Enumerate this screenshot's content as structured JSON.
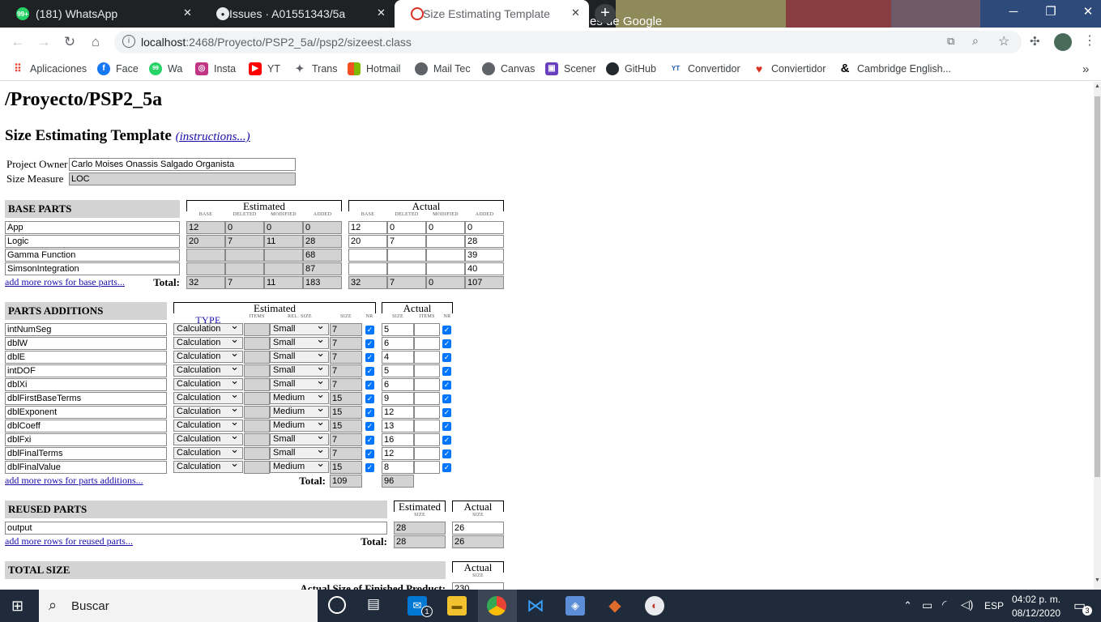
{
  "browser": {
    "tabs": [
      {
        "title": "(181) WhatsApp",
        "badge": "99+"
      },
      {
        "title": "Issues · A01551343/5a"
      },
      {
        "title": "Size Estimating Template",
        "active": true
      }
    ],
    "url_host": "localhost",
    "url_path": ":2468/Proyecto/PSP2_5a//psp2/sizeest.class",
    "bookmarks": [
      "Aplicaciones",
      "Face",
      "Wa",
      "Insta",
      "YT",
      "Trans",
      "Hotmail",
      "Mail Tec",
      "Canvas",
      "Scener",
      "GitHub",
      "Convertidor",
      "Conviertidor",
      "Cambridge English..."
    ],
    "bg_text": "es de Google",
    "overflow": "»"
  },
  "page": {
    "title": "/Proyecto/PSP2_5a",
    "subtitle": "Size Estimating Template",
    "instructions_link": "(instructions...)",
    "project_owner_label": "Project Owner",
    "project_owner": "Carlo Moises Onassis Salgado Organista",
    "size_measure_label": "Size Measure",
    "size_measure": "LOC"
  },
  "base_parts": {
    "heading": "BASE PARTS",
    "estimated_label": "Estimated",
    "actual_label": "Actual",
    "columns": [
      "BASE",
      "DELETED",
      "MODIFIED",
      "ADDED"
    ],
    "rows": [
      {
        "name": "App",
        "est": [
          "12",
          "0",
          "0",
          "0"
        ],
        "act": [
          "12",
          "0",
          "0",
          "0"
        ]
      },
      {
        "name": "Logic",
        "est": [
          "20",
          "7",
          "11",
          "28"
        ],
        "act": [
          "20",
          "7",
          "",
          "28"
        ]
      },
      {
        "name": "Gamma Function",
        "est": [
          "",
          "",
          "",
          "68"
        ],
        "act": [
          "",
          "",
          "",
          "39"
        ]
      },
      {
        "name": "SimsonIntegration",
        "est": [
          "",
          "",
          "",
          "87"
        ],
        "act": [
          "",
          "",
          "",
          "40"
        ]
      }
    ],
    "add_link": "add more rows for base parts...",
    "total_label": "Total:",
    "total_est": [
      "32",
      "7",
      "11",
      "183"
    ],
    "total_act": [
      "32",
      "7",
      "0",
      "107"
    ]
  },
  "parts_additions": {
    "heading": "PARTS ADDITIONS",
    "estimated_label": "Estimated",
    "actual_label": "Actual",
    "est_columns": [
      "TYPE",
      "ITEMS",
      "REL. SIZE",
      "SIZE",
      "NR"
    ],
    "act_columns": [
      "SIZE",
      "ITEMS",
      "NR"
    ],
    "rows": [
      {
        "name": "intNumSeg",
        "type": "Calculation",
        "rel": "Small",
        "size": "7",
        "act": "5"
      },
      {
        "name": "dblW",
        "type": "Calculation",
        "rel": "Small",
        "size": "7",
        "act": "6"
      },
      {
        "name": "dblE",
        "type": "Calculation",
        "rel": "Small",
        "size": "7",
        "act": "4"
      },
      {
        "name": "intDOF",
        "type": "Calculation",
        "rel": "Small",
        "size": "7",
        "act": "5"
      },
      {
        "name": "dblXi",
        "type": "Calculation",
        "rel": "Small",
        "size": "7",
        "act": "6"
      },
      {
        "name": "dblFirstBaseTerms",
        "type": "Calculation",
        "rel": "Medium",
        "size": "15",
        "act": "9"
      },
      {
        "name": "dblExponent",
        "type": "Calculation",
        "rel": "Medium",
        "size": "15",
        "act": "12"
      },
      {
        "name": "dblCoeff",
        "type": "Calculation",
        "rel": "Medium",
        "size": "15",
        "act": "13"
      },
      {
        "name": "dblFxi",
        "type": "Calculation",
        "rel": "Small",
        "size": "7",
        "act": "16"
      },
      {
        "name": "dblFinalTerms",
        "type": "Calculation",
        "rel": "Small",
        "size": "7",
        "act": "12"
      },
      {
        "name": "dblFinalValue",
        "type": "Calculation",
        "rel": "Medium",
        "size": "15",
        "act": "8"
      }
    ],
    "add_link": "add more rows for parts additions...",
    "total_label": "Total:",
    "total_est": "109",
    "total_act": "96"
  },
  "reused_parts": {
    "heading": "REUSED PARTS",
    "estimated_label": "Estimated",
    "actual_label": "Actual",
    "size_label": "SIZE",
    "rows": [
      {
        "name": "output",
        "est": "28",
        "act": "26"
      }
    ],
    "add_link": "add more rows for reused parts...",
    "total_label": "Total:",
    "total_est": "28",
    "total_act": "26"
  },
  "total_size": {
    "heading": "TOTAL SIZE",
    "actual_label": "Actual",
    "size_label": "SIZE",
    "finished_label": "Actual Size of Finished Product:",
    "finished_value": "230"
  },
  "taskbar": {
    "search_placeholder": "Buscar",
    "lang": "ESP",
    "time": "04:02 p. m.",
    "date": "08/12/2020",
    "notif_count": "3",
    "mail_badge": "1"
  }
}
